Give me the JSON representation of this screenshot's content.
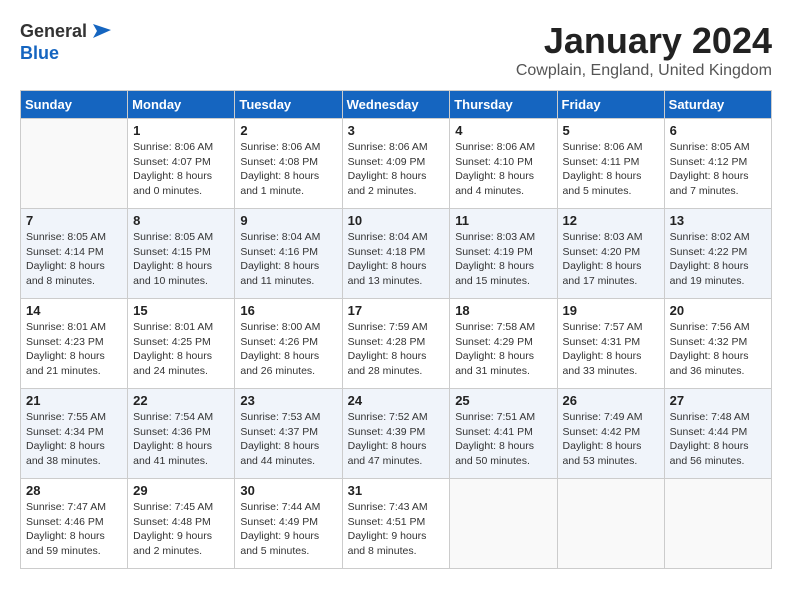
{
  "logo": {
    "general": "General",
    "blue": "Blue"
  },
  "title": "January 2024",
  "location": "Cowplain, England, United Kingdom",
  "days": [
    "Sunday",
    "Monday",
    "Tuesday",
    "Wednesday",
    "Thursday",
    "Friday",
    "Saturday"
  ],
  "weeks": [
    [
      {
        "date": "",
        "sunrise": "",
        "sunset": "",
        "daylight": ""
      },
      {
        "date": "1",
        "sunrise": "Sunrise: 8:06 AM",
        "sunset": "Sunset: 4:07 PM",
        "daylight": "Daylight: 8 hours and 0 minutes."
      },
      {
        "date": "2",
        "sunrise": "Sunrise: 8:06 AM",
        "sunset": "Sunset: 4:08 PM",
        "daylight": "Daylight: 8 hours and 1 minute."
      },
      {
        "date": "3",
        "sunrise": "Sunrise: 8:06 AM",
        "sunset": "Sunset: 4:09 PM",
        "daylight": "Daylight: 8 hours and 2 minutes."
      },
      {
        "date": "4",
        "sunrise": "Sunrise: 8:06 AM",
        "sunset": "Sunset: 4:10 PM",
        "daylight": "Daylight: 8 hours and 4 minutes."
      },
      {
        "date": "5",
        "sunrise": "Sunrise: 8:06 AM",
        "sunset": "Sunset: 4:11 PM",
        "daylight": "Daylight: 8 hours and 5 minutes."
      },
      {
        "date": "6",
        "sunrise": "Sunrise: 8:05 AM",
        "sunset": "Sunset: 4:12 PM",
        "daylight": "Daylight: 8 hours and 7 minutes."
      }
    ],
    [
      {
        "date": "7",
        "sunrise": "Sunrise: 8:05 AM",
        "sunset": "Sunset: 4:14 PM",
        "daylight": "Daylight: 8 hours and 8 minutes."
      },
      {
        "date": "8",
        "sunrise": "Sunrise: 8:05 AM",
        "sunset": "Sunset: 4:15 PM",
        "daylight": "Daylight: 8 hours and 10 minutes."
      },
      {
        "date": "9",
        "sunrise": "Sunrise: 8:04 AM",
        "sunset": "Sunset: 4:16 PM",
        "daylight": "Daylight: 8 hours and 11 minutes."
      },
      {
        "date": "10",
        "sunrise": "Sunrise: 8:04 AM",
        "sunset": "Sunset: 4:18 PM",
        "daylight": "Daylight: 8 hours and 13 minutes."
      },
      {
        "date": "11",
        "sunrise": "Sunrise: 8:03 AM",
        "sunset": "Sunset: 4:19 PM",
        "daylight": "Daylight: 8 hours and 15 minutes."
      },
      {
        "date": "12",
        "sunrise": "Sunrise: 8:03 AM",
        "sunset": "Sunset: 4:20 PM",
        "daylight": "Daylight: 8 hours and 17 minutes."
      },
      {
        "date": "13",
        "sunrise": "Sunrise: 8:02 AM",
        "sunset": "Sunset: 4:22 PM",
        "daylight": "Daylight: 8 hours and 19 minutes."
      }
    ],
    [
      {
        "date": "14",
        "sunrise": "Sunrise: 8:01 AM",
        "sunset": "Sunset: 4:23 PM",
        "daylight": "Daylight: 8 hours and 21 minutes."
      },
      {
        "date": "15",
        "sunrise": "Sunrise: 8:01 AM",
        "sunset": "Sunset: 4:25 PM",
        "daylight": "Daylight: 8 hours and 24 minutes."
      },
      {
        "date": "16",
        "sunrise": "Sunrise: 8:00 AM",
        "sunset": "Sunset: 4:26 PM",
        "daylight": "Daylight: 8 hours and 26 minutes."
      },
      {
        "date": "17",
        "sunrise": "Sunrise: 7:59 AM",
        "sunset": "Sunset: 4:28 PM",
        "daylight": "Daylight: 8 hours and 28 minutes."
      },
      {
        "date": "18",
        "sunrise": "Sunrise: 7:58 AM",
        "sunset": "Sunset: 4:29 PM",
        "daylight": "Daylight: 8 hours and 31 minutes."
      },
      {
        "date": "19",
        "sunrise": "Sunrise: 7:57 AM",
        "sunset": "Sunset: 4:31 PM",
        "daylight": "Daylight: 8 hours and 33 minutes."
      },
      {
        "date": "20",
        "sunrise": "Sunrise: 7:56 AM",
        "sunset": "Sunset: 4:32 PM",
        "daylight": "Daylight: 8 hours and 36 minutes."
      }
    ],
    [
      {
        "date": "21",
        "sunrise": "Sunrise: 7:55 AM",
        "sunset": "Sunset: 4:34 PM",
        "daylight": "Daylight: 8 hours and 38 minutes."
      },
      {
        "date": "22",
        "sunrise": "Sunrise: 7:54 AM",
        "sunset": "Sunset: 4:36 PM",
        "daylight": "Daylight: 8 hours and 41 minutes."
      },
      {
        "date": "23",
        "sunrise": "Sunrise: 7:53 AM",
        "sunset": "Sunset: 4:37 PM",
        "daylight": "Daylight: 8 hours and 44 minutes."
      },
      {
        "date": "24",
        "sunrise": "Sunrise: 7:52 AM",
        "sunset": "Sunset: 4:39 PM",
        "daylight": "Daylight: 8 hours and 47 minutes."
      },
      {
        "date": "25",
        "sunrise": "Sunrise: 7:51 AM",
        "sunset": "Sunset: 4:41 PM",
        "daylight": "Daylight: 8 hours and 50 minutes."
      },
      {
        "date": "26",
        "sunrise": "Sunrise: 7:49 AM",
        "sunset": "Sunset: 4:42 PM",
        "daylight": "Daylight: 8 hours and 53 minutes."
      },
      {
        "date": "27",
        "sunrise": "Sunrise: 7:48 AM",
        "sunset": "Sunset: 4:44 PM",
        "daylight": "Daylight: 8 hours and 56 minutes."
      }
    ],
    [
      {
        "date": "28",
        "sunrise": "Sunrise: 7:47 AM",
        "sunset": "Sunset: 4:46 PM",
        "daylight": "Daylight: 8 hours and 59 minutes."
      },
      {
        "date": "29",
        "sunrise": "Sunrise: 7:45 AM",
        "sunset": "Sunset: 4:48 PM",
        "daylight": "Daylight: 9 hours and 2 minutes."
      },
      {
        "date": "30",
        "sunrise": "Sunrise: 7:44 AM",
        "sunset": "Sunset: 4:49 PM",
        "daylight": "Daylight: 9 hours and 5 minutes."
      },
      {
        "date": "31",
        "sunrise": "Sunrise: 7:43 AM",
        "sunset": "Sunset: 4:51 PM",
        "daylight": "Daylight: 9 hours and 8 minutes."
      },
      {
        "date": "",
        "sunrise": "",
        "sunset": "",
        "daylight": ""
      },
      {
        "date": "",
        "sunrise": "",
        "sunset": "",
        "daylight": ""
      },
      {
        "date": "",
        "sunrise": "",
        "sunset": "",
        "daylight": ""
      }
    ]
  ]
}
